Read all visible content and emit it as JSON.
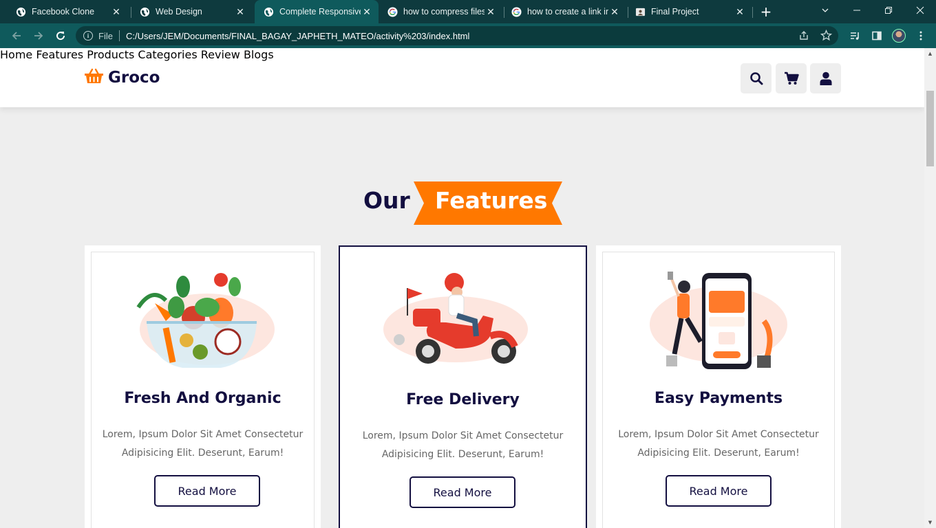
{
  "browser": {
    "tabs": [
      {
        "title": "Facebook Clone",
        "icon": "globe-icon",
        "active": false
      },
      {
        "title": "Web Design",
        "icon": "globe-icon",
        "active": false
      },
      {
        "title": "Complete Responsive",
        "icon": "globe-icon",
        "active": true
      },
      {
        "title": "how to compress files",
        "icon": "google-icon",
        "active": false
      },
      {
        "title": "how to create a link in",
        "icon": "google-icon",
        "active": false
      },
      {
        "title": "Final Project",
        "icon": "document-icon",
        "active": false
      }
    ],
    "address_scheme": "File",
    "address_url": "C:/Users/JEM/Documents/FINAL_BAGAY_JAPHETH_MATEO/activity%203/index.html"
  },
  "site": {
    "logo": "Groco",
    "nav": [
      "Home",
      "Features",
      "Products",
      "Categories",
      "Review",
      "Blogs"
    ],
    "header_icons": [
      "search-icon",
      "cart-icon",
      "user-icon"
    ]
  },
  "features": {
    "heading_our": "Our",
    "heading_features": "Features",
    "cards": [
      {
        "title": "Fresh And Organic",
        "text": "Lorem, Ipsum Dolor Sit Amet Consectetur Adipisicing Elit. Deserunt, Earum!",
        "button": "Read More",
        "image": "vegetable-bowl-illustration"
      },
      {
        "title": "Free Delivery",
        "text": "Lorem, Ipsum Dolor Sit Amet Consectetur Adipisicing Elit. Deserunt, Earum!",
        "button": "Read More",
        "image": "scooter-delivery-illustration"
      },
      {
        "title": "Easy Payments",
        "text": "Lorem, Ipsum Dolor Sit Amet Consectetur Adipisicing Elit. Deserunt, Earum!",
        "button": "Read More",
        "image": "phone-payment-illustration"
      }
    ]
  },
  "colors": {
    "brand_orange": "#ff7800",
    "brand_navy": "#130f40",
    "chrome_dark": "#0e3a3e",
    "chrome_toolbar": "#0f5a5c"
  }
}
